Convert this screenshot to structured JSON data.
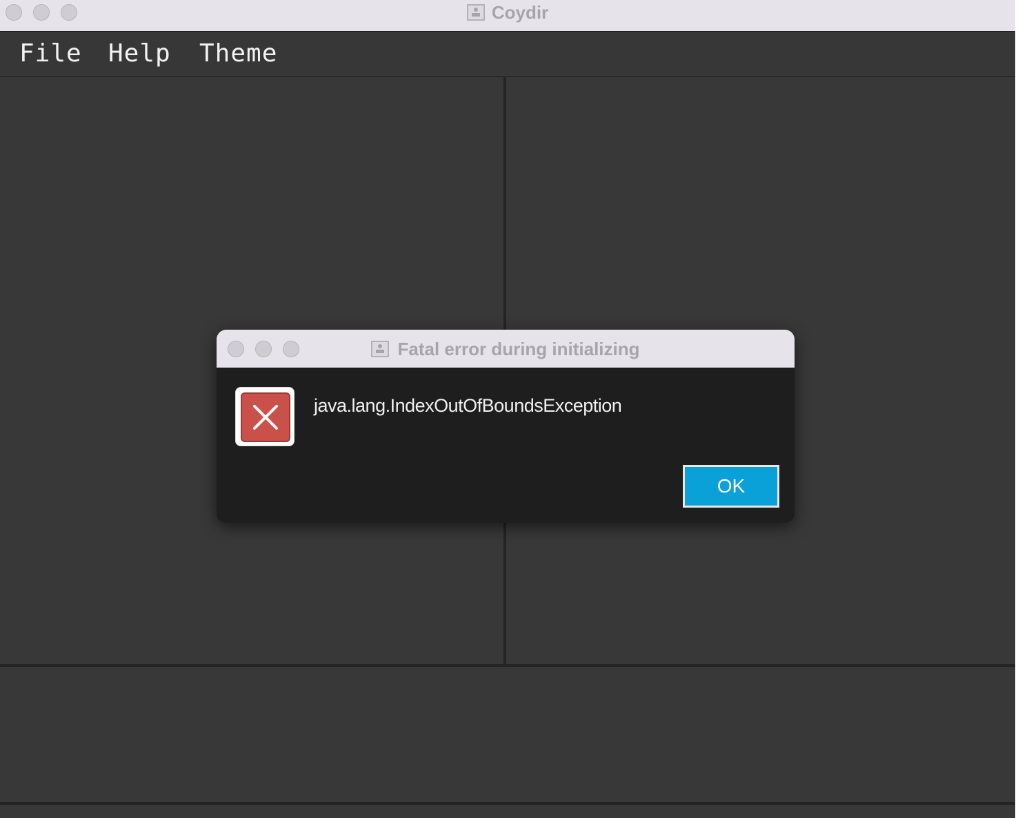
{
  "window": {
    "title": "Coydir",
    "icon": "document-icon"
  },
  "menubar": {
    "items": [
      {
        "label": "File"
      },
      {
        "label": "Help"
      },
      {
        "label": "Theme"
      }
    ]
  },
  "dialog": {
    "title": "Fatal error during initializing",
    "icon": "error-x-icon",
    "message": "java.lang.IndexOutOfBoundsException",
    "ok_label": "OK"
  },
  "colors": {
    "background": "#383838",
    "titlebar": "#e6e4ea",
    "dialog_body": "#1e1e1e",
    "ok_button": "#0aa0d8",
    "error_icon": "#c9514a"
  }
}
